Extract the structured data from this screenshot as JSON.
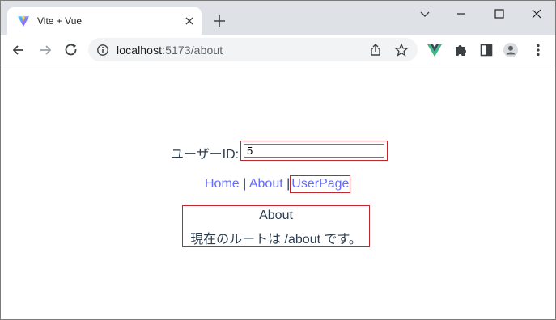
{
  "browser": {
    "tab": {
      "title": "Vite + Vue",
      "favicon": "vite-logo-icon"
    },
    "address_bar": {
      "host": "localhost",
      "path": ":5173/about"
    },
    "accent_colors": {
      "link": "#646cff",
      "outline": "#c0262d",
      "text": "#2c3e50"
    }
  },
  "page": {
    "user_id": {
      "label": "ユーザーID:",
      "value": "5"
    },
    "nav": {
      "home": "Home",
      "about": "About",
      "userpage": "UserPage",
      "separator": "|"
    },
    "about": {
      "title": "About",
      "route_text": "現在のルートは /about です。"
    }
  }
}
